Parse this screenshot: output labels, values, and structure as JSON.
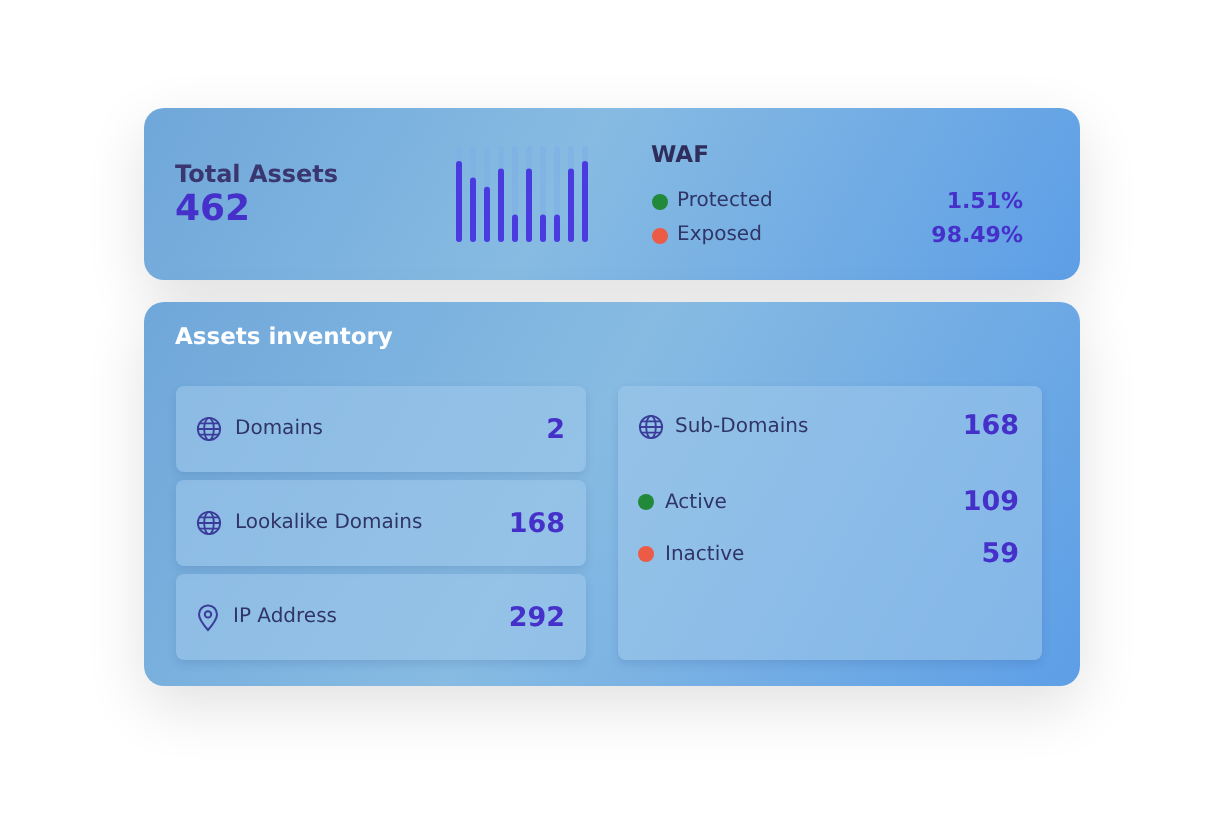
{
  "summary": {
    "title": "Total Assets",
    "value": "462"
  },
  "waf": {
    "title": "WAF",
    "items": [
      {
        "label": "Protected",
        "color": "#23893a",
        "value": "1.51%"
      },
      {
        "label": "Exposed",
        "color": "#ec5b45",
        "value": "98.49%"
      }
    ]
  },
  "inventory": {
    "title": "Assets inventory",
    "items": [
      {
        "kind": "domain",
        "label": "Domains",
        "value": "2"
      },
      {
        "kind": "domain",
        "label": "Lookalike Domains",
        "value": "168"
      },
      {
        "kind": "location",
        "label": "IP Address",
        "value": "292"
      }
    ],
    "subdomains": {
      "label": "Sub-Domains",
      "value": "168",
      "items": [
        {
          "label": "Active",
          "color": "#23893a",
          "value": "109"
        },
        {
          "label": "Inactive",
          "color": "#ec5b45",
          "value": "59"
        }
      ]
    }
  }
}
